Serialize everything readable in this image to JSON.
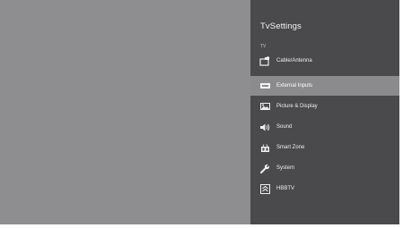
{
  "panel": {
    "title": "TvSettings",
    "section_label": "TV",
    "items": [
      {
        "label": "Cable/Antenna",
        "icon": "antenna-icon",
        "selected": false
      },
      {
        "label": "External Inputs",
        "icon": "input-icon",
        "selected": true
      },
      {
        "label": "Picture & Display",
        "icon": "picture-icon",
        "selected": false
      },
      {
        "label": "Sound",
        "icon": "speaker-icon",
        "selected": false
      },
      {
        "label": "Smart Zone",
        "icon": "smart-zone-icon",
        "selected": false
      },
      {
        "label": "System",
        "icon": "wrench-icon",
        "selected": false
      },
      {
        "label": "HBBTV",
        "icon": "hbbtv-icon",
        "selected": false
      }
    ]
  },
  "colors": {
    "screen": "#8e8e90",
    "panel": "#4a4a4c",
    "selected": "#8b8b8d"
  }
}
